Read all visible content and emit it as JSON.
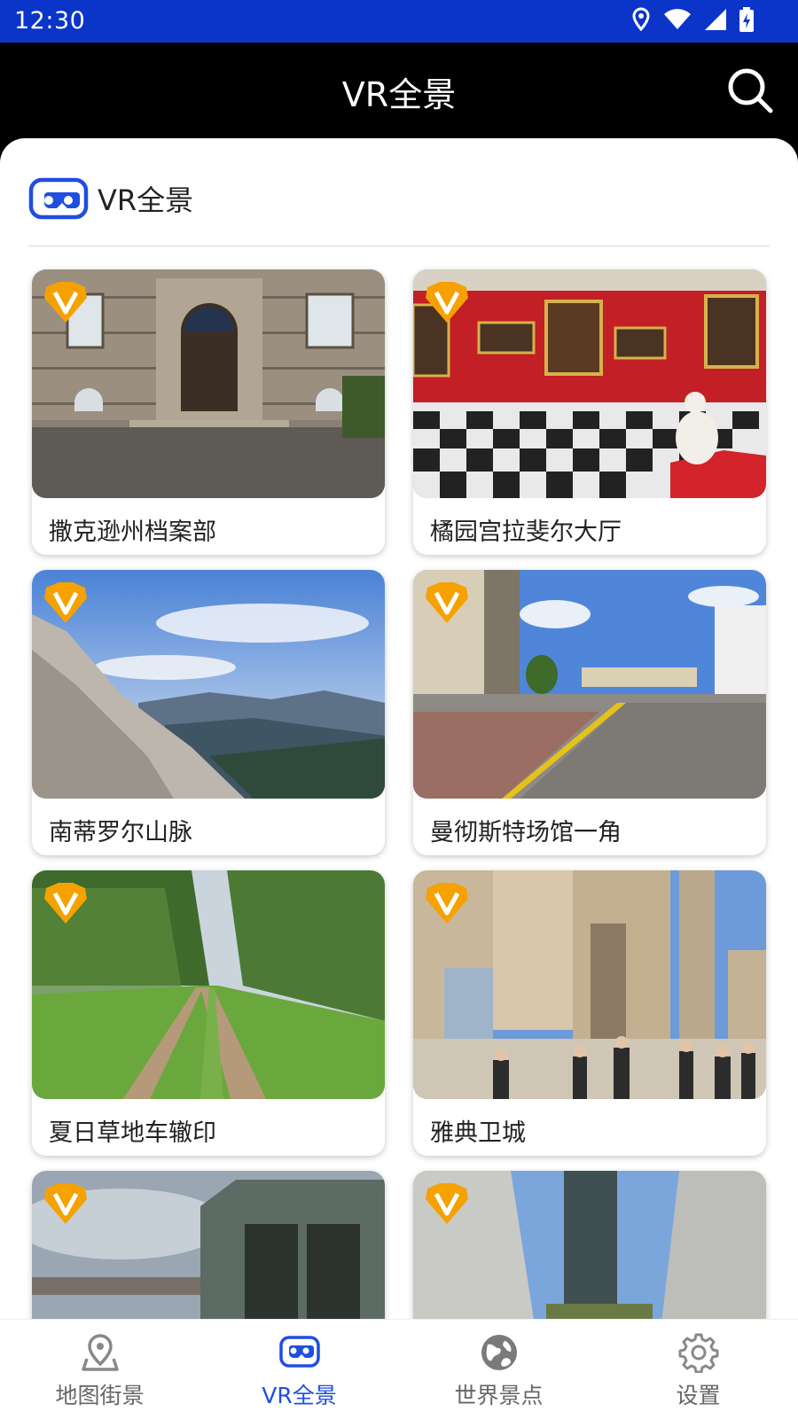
{
  "status_bar": {
    "time": "12:30",
    "icons": [
      "location-icon",
      "wifi-icon",
      "signal-icon",
      "battery-icon"
    ]
  },
  "header": {
    "title": "VR全景",
    "search_icon": "search-icon"
  },
  "section": {
    "title": "VR全景",
    "icon": "vr-goggles-icon"
  },
  "cards": [
    {
      "label": "撒克逊州档案部",
      "badge": "V"
    },
    {
      "label": "橘园宫拉斐尔大厅",
      "badge": "V"
    },
    {
      "label": "南蒂罗尔山脉",
      "badge": "V"
    },
    {
      "label": "曼彻斯特场馆一角",
      "badge": "V"
    },
    {
      "label": "夏日草地车辙印",
      "badge": "V"
    },
    {
      "label": "雅典卫城",
      "badge": "V"
    },
    {
      "label": "",
      "badge": "V"
    },
    {
      "label": "",
      "badge": "V"
    }
  ],
  "bottom_nav": {
    "items": [
      {
        "label": "地图街景",
        "icon": "map-pin-icon",
        "active": false
      },
      {
        "label": "VR全景",
        "icon": "vr-goggles-icon",
        "active": true
      },
      {
        "label": "世界景点",
        "icon": "globe-icon",
        "active": false
      },
      {
        "label": "设置",
        "icon": "gear-icon",
        "active": false
      }
    ]
  },
  "colors": {
    "status_bar": "#0b35c9",
    "accent": "#1f4ee0",
    "badge": "#f5a200"
  }
}
